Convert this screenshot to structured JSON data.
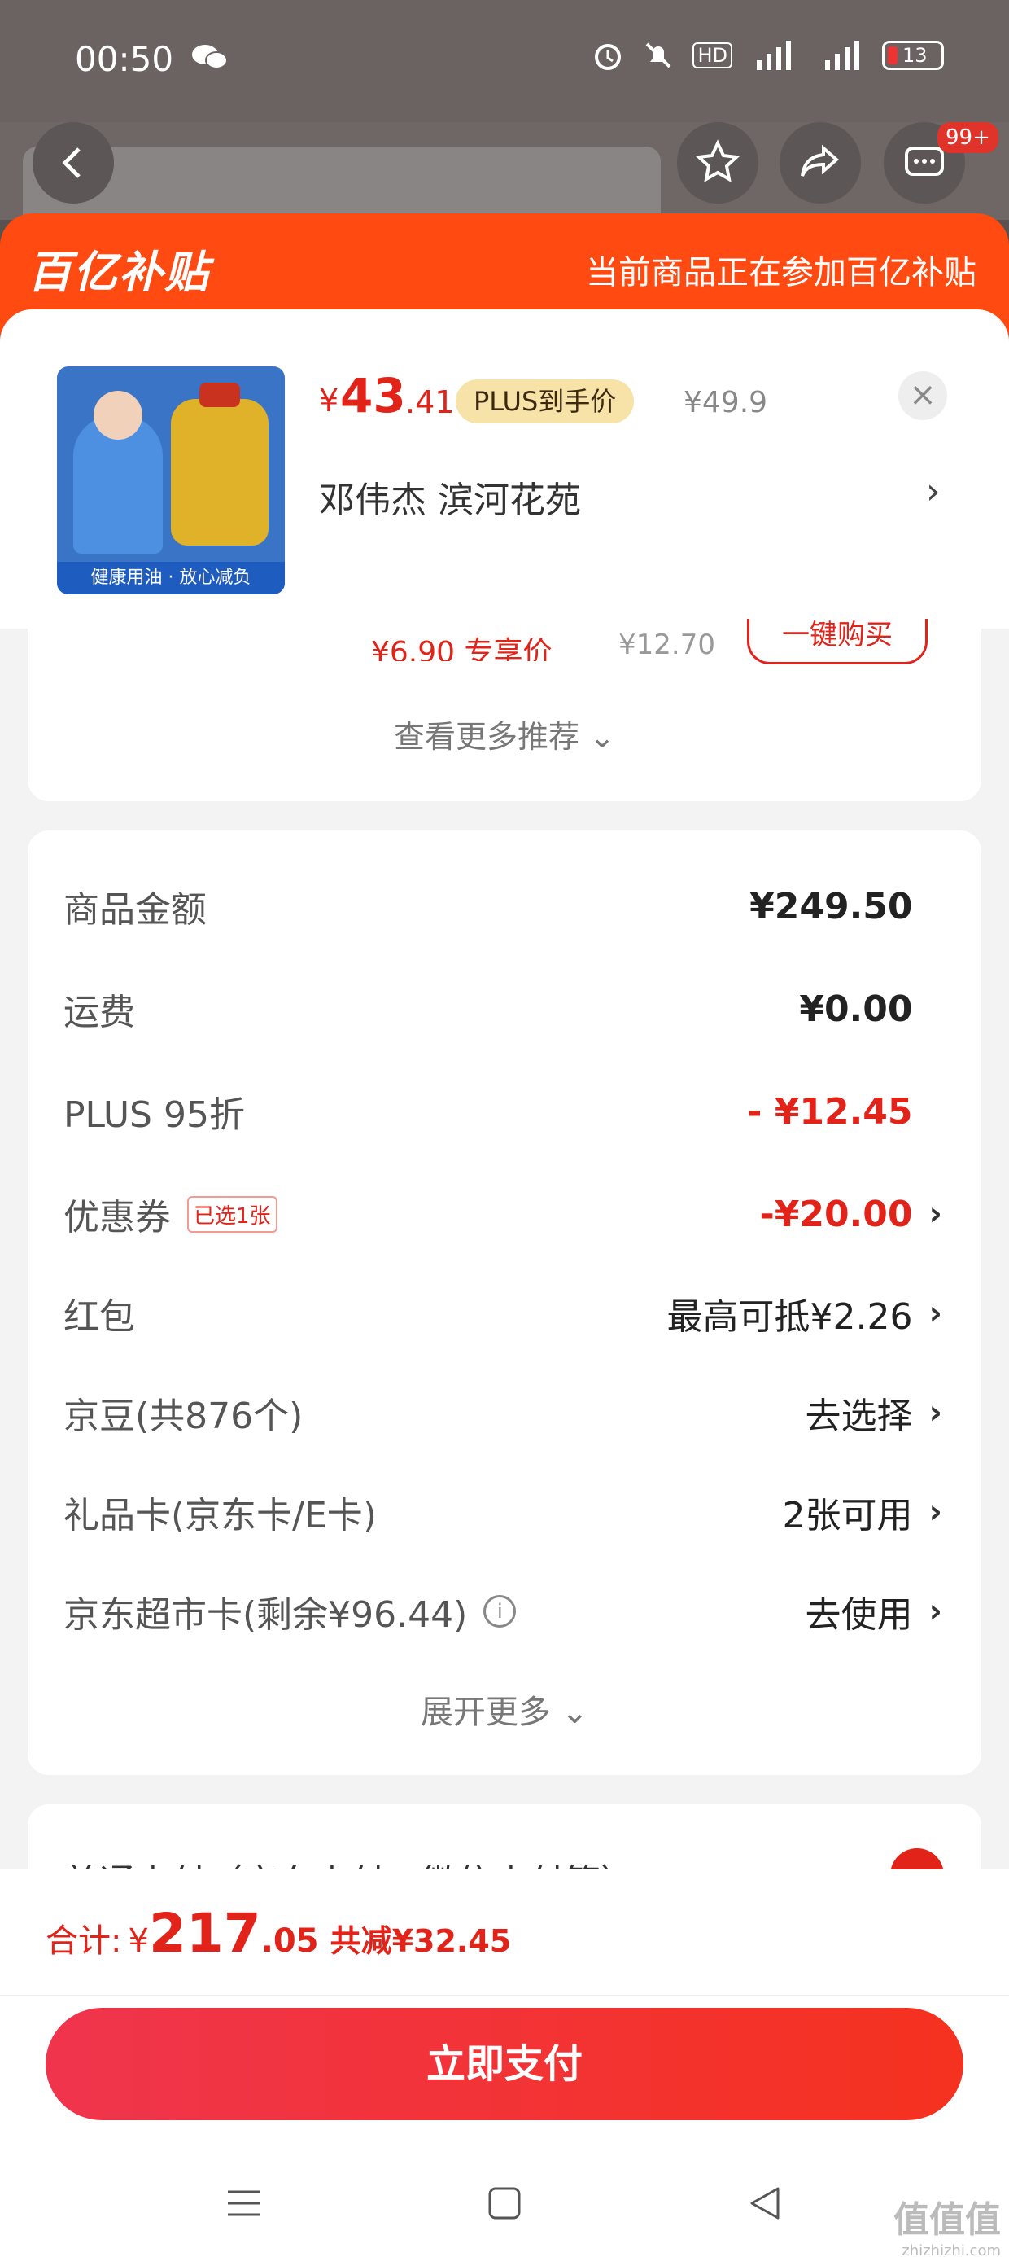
{
  "status_bar": {
    "time": "00:50",
    "hd_label": "HD",
    "battery": "13"
  },
  "top_actions": {
    "badge": "99+"
  },
  "header": {
    "logo": "百亿补贴",
    "note": "当前商品正在参加百亿补贴"
  },
  "product": {
    "image_caption": "健康用油 · 放心减负",
    "price_currency": "¥",
    "price_integer": "43",
    "price_decimal": ".41",
    "plus_tag": "PLUS到手价",
    "original_price": "¥49.9",
    "address": "邓伟杰  滨河花苑"
  },
  "recommend": {
    "partial_price": "¥6.90  专享价",
    "partial_orig": "¥12.70",
    "buy_button": "一键购买",
    "more_label": "查看更多推荐 ⌄"
  },
  "summary": {
    "rows": [
      {
        "label": "商品金额",
        "value": "¥249.50"
      },
      {
        "label": "运费",
        "value": "¥0.00"
      },
      {
        "label": "PLUS 95折",
        "value": "- ¥12.45"
      },
      {
        "label": "优惠券",
        "tag": "已选1张",
        "value": "-¥20.00"
      },
      {
        "label": "红包",
        "value": "最高可抵¥2.26"
      },
      {
        "label": "京豆(共876个)",
        "value": "去选择"
      },
      {
        "label": "礼品卡(京东卡/E卡)",
        "value": "2张可用"
      },
      {
        "label": "京东超市卡(剩余¥96.44)",
        "value": "去使用"
      }
    ],
    "expand_label": "展开更多 ⌄"
  },
  "payment": {
    "method_partial": "普通支付（京东支付、微信支付等）"
  },
  "footer": {
    "total_label": "合计:",
    "total_currency": "¥",
    "total_integer": "217",
    "total_decimal": ".05",
    "total_saved": "共减¥32.45",
    "pay_button": "立即支付"
  },
  "watermark": {
    "logo": "值值值",
    "site": "zhizhizhi.com"
  },
  "colors": {
    "accent_red": "#e2231a",
    "header_orange": "#ff4a12"
  }
}
